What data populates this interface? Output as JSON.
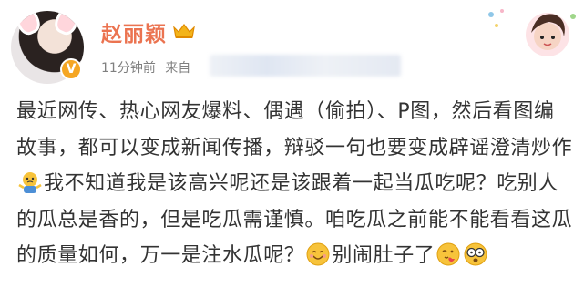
{
  "user": {
    "name": "赵丽颖",
    "time": "11分钟前",
    "source_prefix": "来自"
  },
  "post": {
    "line1": "最近网传、热心网友爆料、偶遇（偷拍）、P图，然后看图编故事，都可以变成新闻传播，辩驳一句也要变成辟谣澄清炒作",
    "line2": "我不知道我是该高兴呢还是该跟着一起当瓜吃呢？吃别人的瓜总是香的，但是吃瓜需谨慎。咱吃瓜之前能不能看看这瓜的质量如何，万一是注水瓜呢？",
    "line3": "别闹肚子了"
  },
  "icons": {
    "verified": "verified-badge-icon",
    "crown": "crown-icon",
    "emoji1": "shrug-emoji-icon",
    "emoji2": "smile-emoji-icon",
    "emoji3": "kiss-emoji-icon",
    "emoji4": "glasses-emoji-icon"
  },
  "colors": {
    "username": "#eb7350",
    "meta": "#808080",
    "text": "#333333"
  }
}
